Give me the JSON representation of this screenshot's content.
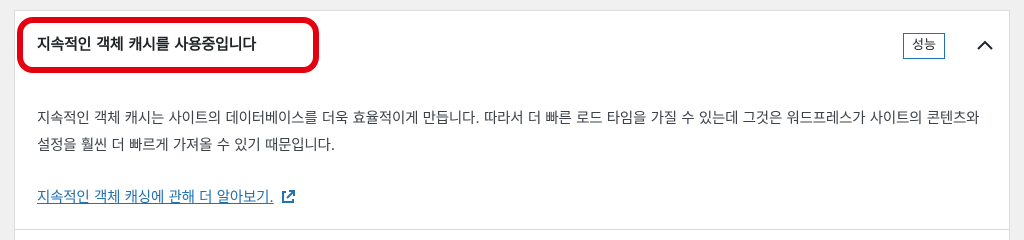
{
  "section": {
    "title": "지속적인 객체 캐시를 사용중입니다",
    "badge": "성능",
    "toggle_icon": "chevron-up-icon",
    "description": "지속적인 객체 캐시는 사이트의 데이터베이스를 더욱 효율적이게 만듭니다. 따라서 더 빠른 로드 타임을 가질 수 있는데 그것은 워드프레스가 사이트의 콘텐츠와 설정을 훨씬 더 빠르게 가져올 수 있기 때문입니다.",
    "learn_more_label": "지속적인 객체 캐싱에 관해 더 알아보기.",
    "link_icon": "external-link-icon"
  },
  "colors": {
    "highlight": "#e4000f",
    "accent": "#2271b1",
    "text": "#1d2327"
  }
}
